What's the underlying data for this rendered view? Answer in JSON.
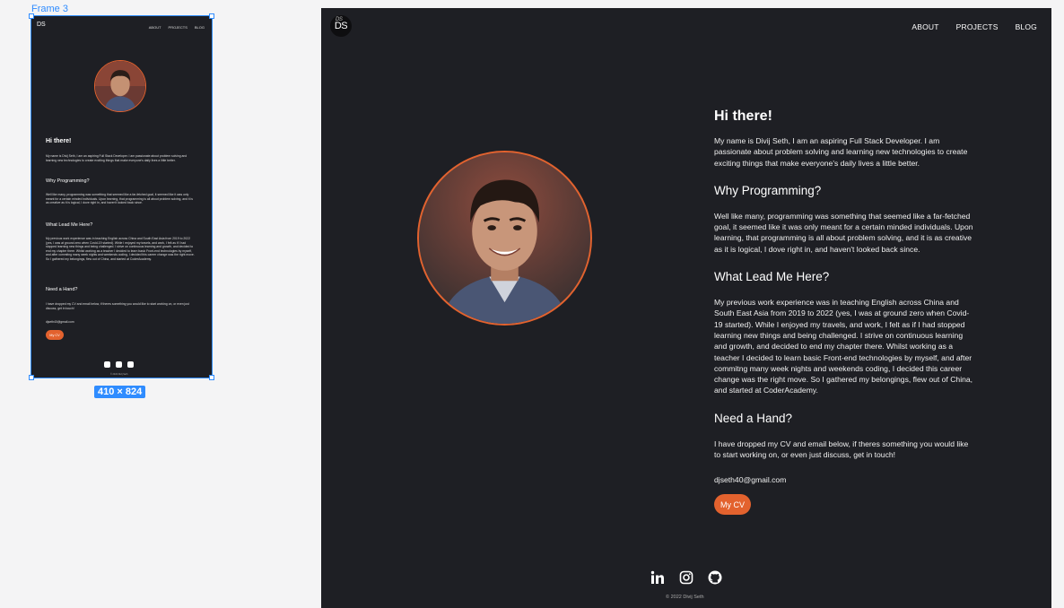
{
  "canvas": {
    "frame_label": "Frame 3",
    "size_badge": "410 × 824"
  },
  "site": {
    "logo": {
      "text": "DS",
      "signature": "DS"
    },
    "nav": [
      "ABOUT",
      "PROJECTS",
      "BLOG"
    ],
    "hero": {
      "greeting": "Hi there!",
      "intro": "My name is Divij Seth, I am an aspiring Full Stack Developer. I am passionate about problem solving and learning new technologies to create exciting things that make everyone's daily lives a little better."
    },
    "sections": [
      {
        "heading": "Why Programming?",
        "body": "Well like many, programming was something that seemed like a far-fetched goal, it seemed like it was only meant for a certain minded individuals. Upon learning, that programming is all about problem solving, and it is as creative as it is logical, I dove right in, and haven't looked back since."
      },
      {
        "heading": "What Lead Me Here?",
        "body": "My previous work experience was in teaching English across China and South East Asia from 2019 to 2022 (yes, I was at ground zero when Covid-19 started). While I enjoyed my travels, and work, I felt as if I had stopped learning new things and being challenged. I strive on continuous learning and growth, and decided to end my chapter there. Whilst working as a teacher I decided to learn basic Front-end technologies by myself, and after commitng many week nights and weekends coding, I decided this career change was the right move. So I gathered my belongings, flew out of China, and started at CoderAcademy."
      },
      {
        "heading": "Need a Hand?",
        "body": "I have dropped my CV and email below, if theres something you would like to start working on, or even just discuss, get in touch!"
      }
    ],
    "email": "djseth40@gmail.com",
    "cv_button": "My CV",
    "social": [
      "linkedin-icon",
      "instagram-icon",
      "github-icon"
    ],
    "footer": "© 2022 Divij Seth",
    "colors": {
      "background": "#1e1f24",
      "accent": "#e3622e",
      "selection": "#2f8cff"
    }
  }
}
